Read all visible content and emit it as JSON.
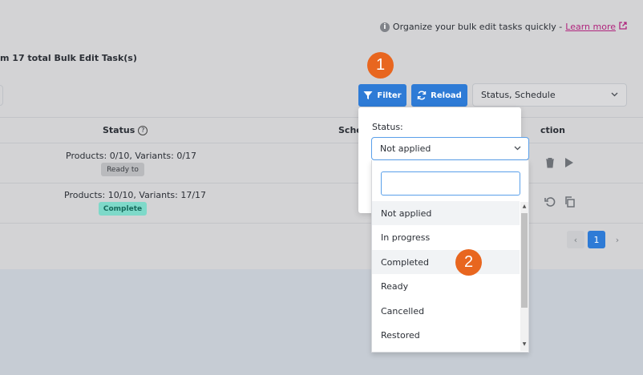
{
  "info": {
    "text": "Organize your bulk edit tasks quickly -",
    "link_label": "Learn more"
  },
  "header": {
    "total_text": "m 17 total Bulk Edit Task(s)"
  },
  "toolbar": {
    "filter_label": "Filter",
    "reload_label": "Reload",
    "columns_select_value": "Status, Schedule"
  },
  "steps": {
    "step1": "1",
    "step2": "2"
  },
  "table": {
    "headers": {
      "status": "Status",
      "schedule": "Sche",
      "action": "ction"
    },
    "rows": [
      {
        "status_text": "Products: 0/10, Variants: 0/17",
        "badge": "Ready to"
      },
      {
        "status_text": "Products: 10/10, Variants: 17/17",
        "badge": "Complete"
      }
    ]
  },
  "pagination": {
    "prev": "‹",
    "current": "1",
    "next": "›"
  },
  "filter_popup": {
    "label": "Status:",
    "selected": "Not applied",
    "options": [
      "Not applied",
      "In progress",
      "Completed",
      "Ready",
      "Cancelled",
      "Restored"
    ]
  },
  "colors": {
    "primary": "#2e7bd6",
    "step_badge": "#e8661f",
    "link": "#b0247d",
    "complete_badge": "#7ed9c9"
  }
}
